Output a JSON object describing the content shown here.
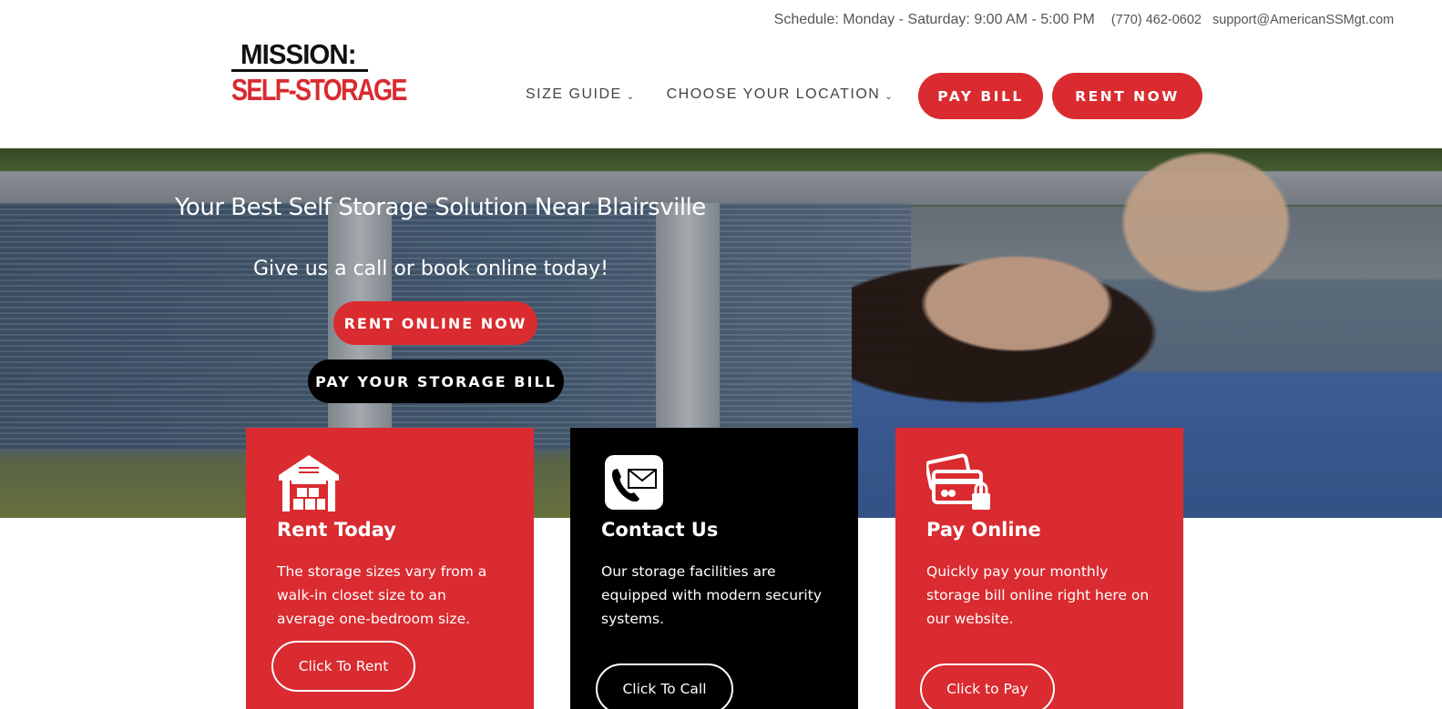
{
  "topbar": {
    "schedule": "Schedule: Monday - Saturday: 9:00 AM - 5:00 PM",
    "phone": "(770) 462-0602",
    "email": "support@AmericanSSMgt.com"
  },
  "logo": {
    "line1": "MISSION:",
    "line2": "SELF-STORAGE"
  },
  "nav": {
    "items": [
      {
        "label": "SIZE GUIDE"
      },
      {
        "label": "CHOOSE YOUR LOCATION"
      }
    ],
    "pay_bill": "PAY BILL",
    "rent_now": "RENT NOW"
  },
  "hero": {
    "title": "Your Best Self Storage Solution Near Blairsville",
    "subtitle": "Give us a call or book online today!",
    "rent_online": "RENT ONLINE NOW",
    "pay_storage": "PAY YOUR STORAGE BILL"
  },
  "cards": [
    {
      "title": "Rent Today",
      "text": "The storage sizes vary from a walk-in closet size to an average one-bedroom size.",
      "button": "Click To Rent",
      "icon": "warehouse-icon"
    },
    {
      "title": "Contact Us",
      "text": "Our storage facilities are equipped with modern security systems.",
      "button": "Click To Call",
      "icon": "phone-mail-icon"
    },
    {
      "title": "Pay Online",
      "text": "Quickly pay your monthly storage bill online right here on our website.",
      "button": "Click to Pay",
      "icon": "credit-card-lock-icon"
    }
  ],
  "colors": {
    "brand_red": "#d92b30",
    "black": "#000000",
    "white": "#ffffff"
  }
}
